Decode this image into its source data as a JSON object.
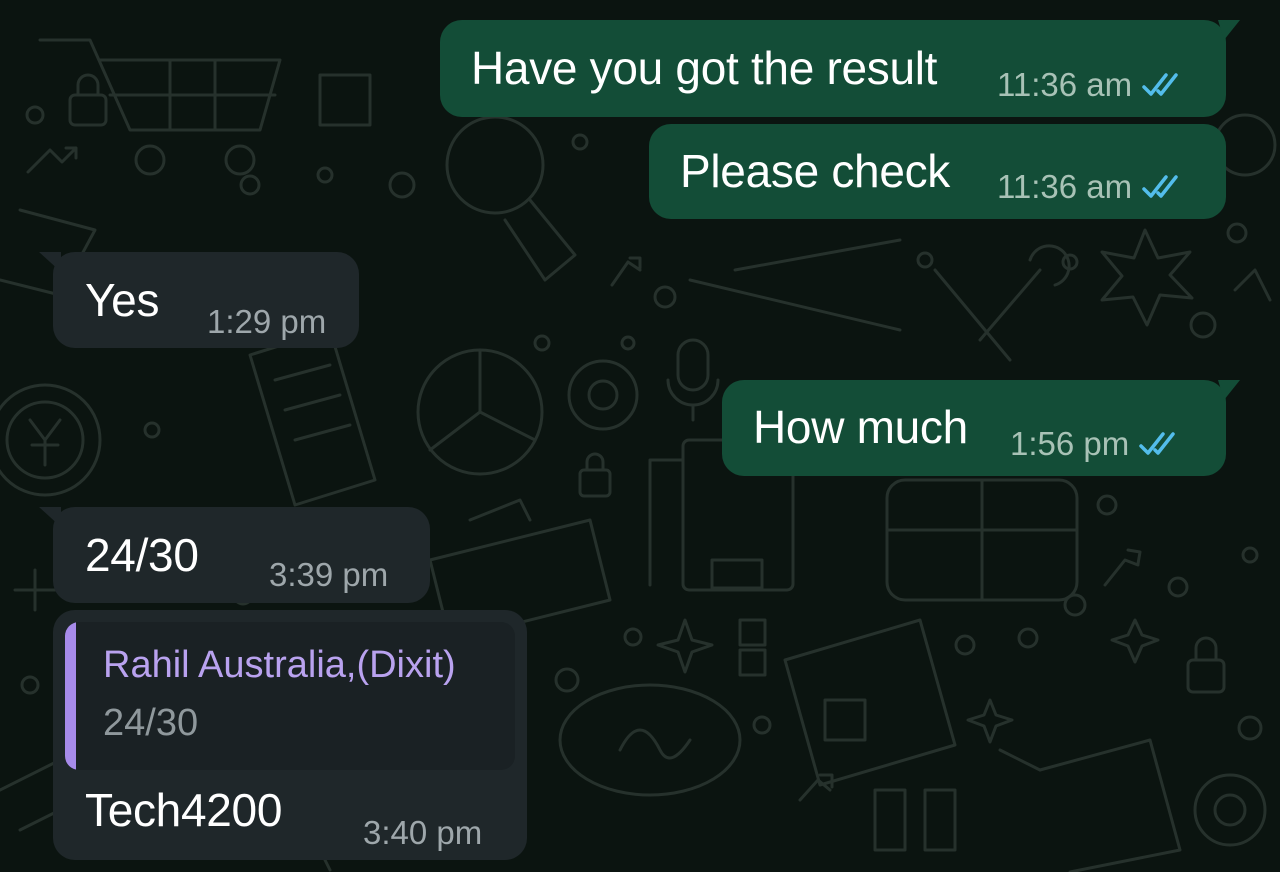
{
  "colors": {
    "background": "#0b1410",
    "outgoing_bubble": "#134d37",
    "incoming_bubble": "#1f272a",
    "read_ticks": "#53bdeb",
    "quote_accent": "#a78bea"
  },
  "messages": [
    {
      "direction": "outgoing",
      "text": "Have you got the result",
      "time": "11:36 am",
      "status": "read"
    },
    {
      "direction": "outgoing",
      "text": "Please check",
      "time": "11:36 am",
      "status": "read"
    },
    {
      "direction": "incoming",
      "text": "Yes",
      "time": "1:29 pm"
    },
    {
      "direction": "outgoing",
      "text": "How much",
      "time": "1:56 pm",
      "status": "read"
    },
    {
      "direction": "incoming",
      "text": "24/30",
      "time": "3:39 pm"
    },
    {
      "direction": "incoming",
      "text": "Tech4200",
      "time": "3:40 pm",
      "quoted": {
        "author": "Rahil Australia,(Dixit)",
        "text": "24/30"
      }
    }
  ],
  "icons": {
    "read_receipt": "double-check-icon",
    "background": "doodle-pattern"
  }
}
